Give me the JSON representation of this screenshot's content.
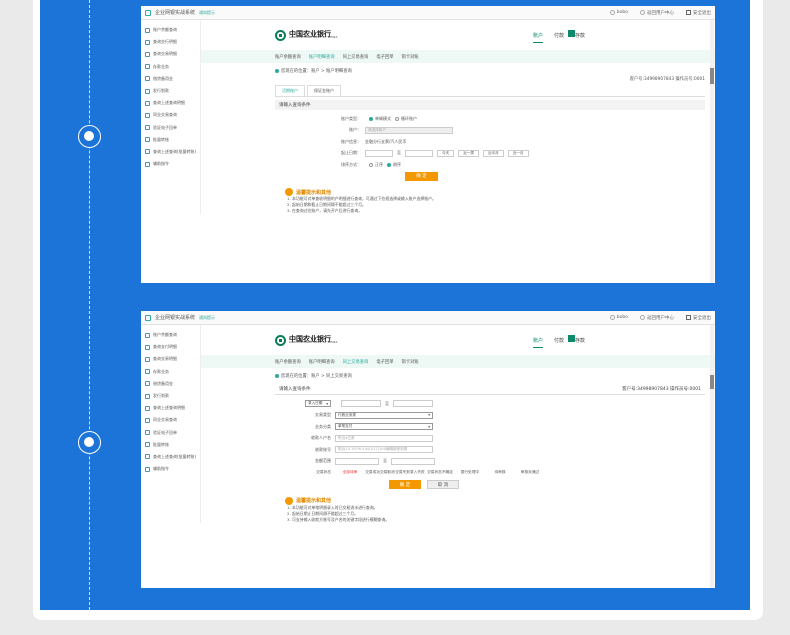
{
  "shot1": {
    "system_title": "企业网银实战系统",
    "system_tag": "通知提示",
    "user": "bobo",
    "user_center": "返回用户中心",
    "exit": "安全退出",
    "sidebar": [
      "账户余额查询",
      "查询交行明细",
      "查询交易明细",
      "存款业务",
      "借贷备用金",
      "发行划款",
      "查询上述查询明细",
      "同业交易查询",
      "验证电子回单",
      "批量转账",
      "查询上述查询(批量转账)",
      "辅助指令"
    ],
    "bank_name_cn": "中国农业银行",
    "bank_name_en": "AGRICULTURAL BANK OF CHINA",
    "top_nav": [
      "账户",
      "付款",
      "存款"
    ],
    "sub_nav": [
      "账户余额查询",
      "账户明细查询",
      "同上交易查询",
      "电子回单",
      "销卡对账"
    ],
    "breadcrumb": "您现在的位置：账户 > 账户明细查询",
    "acct_info": "客户号:34998907843    操作员号:0001",
    "tabs": [
      "活期账户",
      "保证金账户"
    ],
    "section_title": "请输入查询条件",
    "form": {
      "acct_type_label": "账户类型：",
      "acct_type_opt1": "单辆模式",
      "acct_type_opt2": "循环账户",
      "acct_label": "账户：",
      "acct_placeholder": "请选择账户",
      "acct_info_label": "账户信息：",
      "acct_info_value": "金融分行支票/汽人民币",
      "date_label": "起止日期：",
      "date_sep": "至",
      "date_btns": [
        "今天",
        "近一周",
        "近半月",
        "近一月"
      ],
      "sort_label": "排序方式：",
      "sort_opt1": "正序",
      "sort_opt2": "倒序",
      "submit": "确  定"
    },
    "tips_title": "温馨提示和其他",
    "tips": [
      "1. 本功能可对单查收明细的户明细进行查询，可通过下拉框选择或输入账户选择账户。",
      "2. 起始日期和截止日期间隔不能超过三个月。",
      "3. 在查询过往账户，请先开户后进行查询。"
    ]
  },
  "shot2": {
    "system_title": "企业网银实战系统",
    "system_tag": "通知提示",
    "user": "bobo",
    "user_center": "返回用户中心",
    "exit": "安全退出",
    "sidebar": [
      "账户余额查询",
      "查询支付明细",
      "查询交易明细",
      "存款业务",
      "借贷备用金",
      "发行划款",
      "查询上述查询明细",
      "同业交易查询",
      "验证电子回单",
      "批量转账",
      "查询上述查询(批量转账)",
      "辅助指令"
    ],
    "bank_name_cn": "中国农业银行",
    "bank_name_en": "AGRICULTURAL BANK OF CHINA",
    "top_nav": [
      "账户",
      "付款",
      "存款"
    ],
    "sub_nav": [
      "账户余额查询",
      "账户明细查询",
      "同上交易查询",
      "电子回单",
      "销卡对账"
    ],
    "breadcrumb": "您现在的位置：账户 > 同上交易查询",
    "section_title": "请输入查询条件",
    "acct_info": "客户号:34998907843    操作员号:0001",
    "form": {
      "date_type": "录入日期",
      "date_sep": "至",
      "trade_type_label": "交易类型",
      "trade_type_value": "行政业务类",
      "biz_type_label": "业务分类",
      "biz_type_value": "单笔支付",
      "payer_label": "收款人户名",
      "payer_placeholder": "附近4位数",
      "acct_no_label": "收款账号",
      "acct_no_placeholder": "附近13-19790104(017)100编辑新账新数",
      "amount_label": "金额范围",
      "amount_sep": "至",
      "status_label": "交易状态",
      "status_items": [
        "全部待审",
        "交易成功交易取消",
        "交易失败录入失败",
        "交易状态不确定",
        "银行处理中",
        "待审核",
        "审核未通过"
      ],
      "submit": "确  定",
      "cancel": "取  消"
    },
    "tips_title": "温馨提示和其他",
    "tips": [
      "1. 本功能可对单笔明细录入时已交易流水进行查询。",
      "2. 起始日期止日期间隔不能超过三个月。",
      "3. 可支持输入收款方账号及户名的关键字段进行模糊查询。"
    ]
  },
  "colors": {
    "brand_green": "#0a8a6a",
    "accent": "#2aa99c",
    "orange": "#f39800",
    "blue_bg": "#1d74d8"
  }
}
